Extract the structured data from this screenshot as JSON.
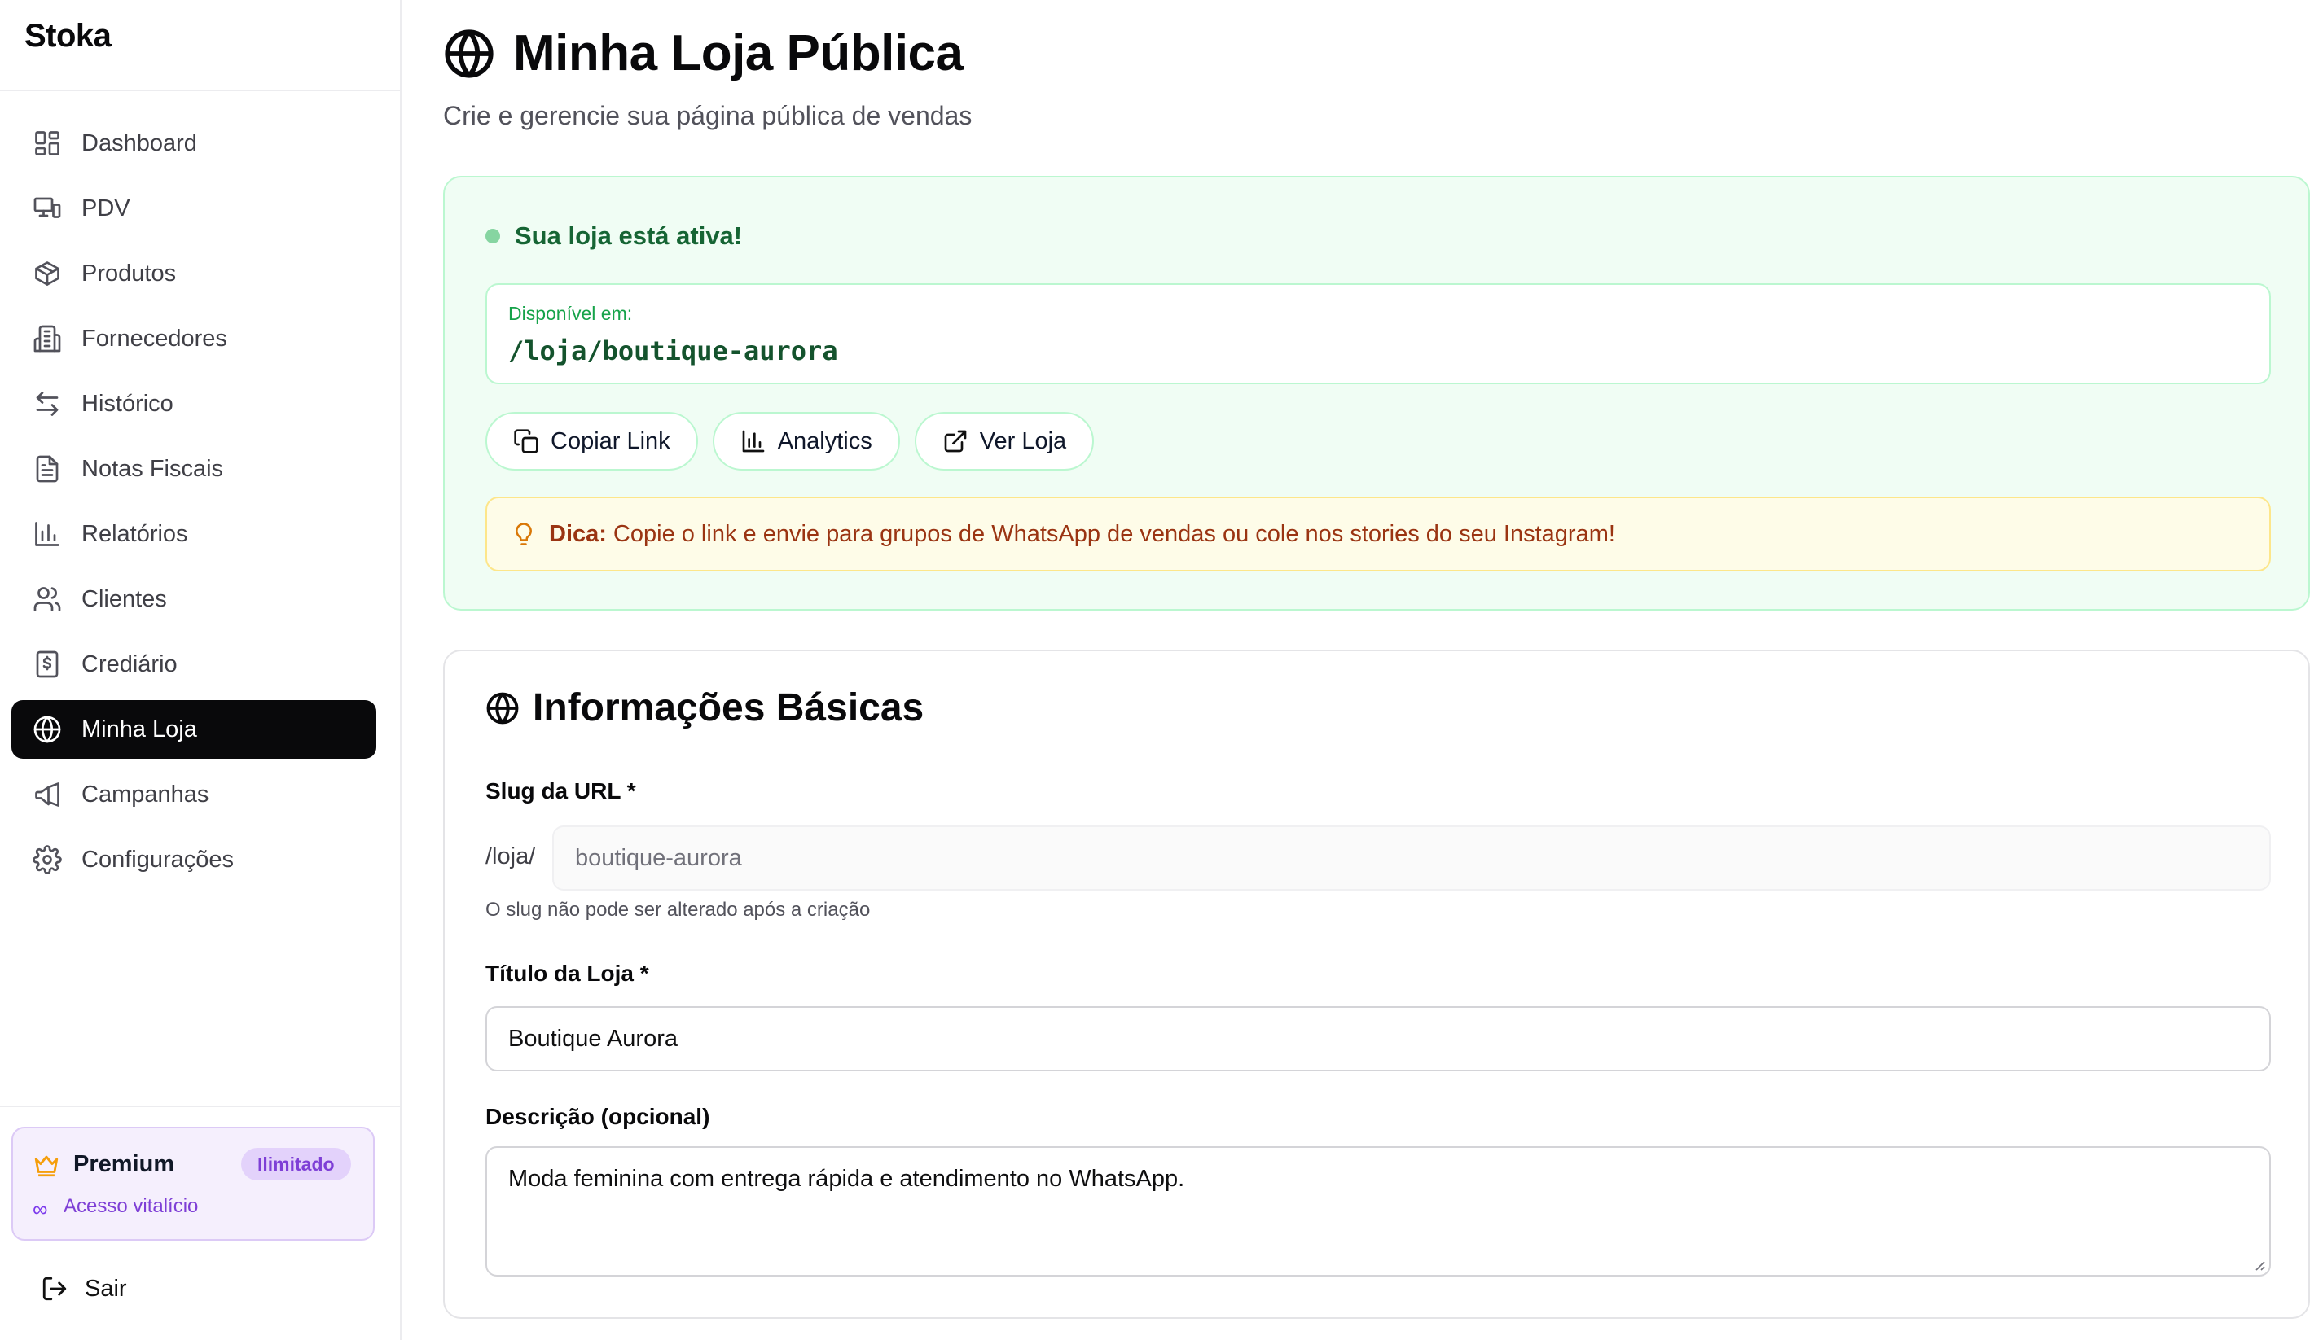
{
  "sidebar": {
    "brand": "Stoka",
    "items": [
      {
        "label": "Dashboard",
        "icon": "dashboard-icon"
      },
      {
        "label": "PDV",
        "icon": "pos-icon"
      },
      {
        "label": "Produtos",
        "icon": "box-icon"
      },
      {
        "label": "Fornecedores",
        "icon": "building-icon"
      },
      {
        "label": "Histórico",
        "icon": "arrows-icon"
      },
      {
        "label": "Notas Fiscais",
        "icon": "file-icon"
      },
      {
        "label": "Relatórios",
        "icon": "chart-icon"
      },
      {
        "label": "Clientes",
        "icon": "users-icon"
      },
      {
        "label": "Crediário",
        "icon": "receipt-icon"
      },
      {
        "label": "Minha Loja",
        "icon": "globe-icon",
        "active": true
      },
      {
        "label": "Campanhas",
        "icon": "megaphone-icon"
      },
      {
        "label": "Configurações",
        "icon": "gear-icon"
      }
    ],
    "premium": {
      "title": "Premium",
      "badge": "Ilimitado",
      "infinity": "∞",
      "subtitle": "Acesso vitalício"
    },
    "logout_label": "Sair"
  },
  "header": {
    "title": "Minha Loja Pública",
    "subtitle": "Crie e gerencie sua página pública de vendas"
  },
  "status": {
    "headline": "Sua loja está ativa!",
    "available_label": "Disponível em:",
    "url": "/loja/boutique-aurora",
    "buttons": {
      "copy": "Copiar Link",
      "analytics": "Analytics",
      "view": "Ver Loja"
    },
    "tip_label": "Dica:",
    "tip_text": "Copie o link e envie para grupos de WhatsApp de vendas ou cole nos stories do seu Instagram!"
  },
  "info": {
    "title": "Informações Básicas",
    "slug_label": "Slug da URL *",
    "slug_prefix": "/loja/",
    "slug_value": "boutique-aurora",
    "slug_hint": "O slug não pode ser alterado após a criação",
    "store_title_label": "Título da Loja *",
    "store_title_value": "Boutique Aurora",
    "description_label": "Descrição (opcional)",
    "description_value": "Moda feminina com entrega rápida e atendimento no WhatsApp."
  },
  "colors": {
    "active_nav_bg": "#09090b",
    "success_bg": "#f0fdf4",
    "success_text": "#166534",
    "tip_bg": "#fefce8",
    "premium_accent": "#7e3fd6"
  }
}
